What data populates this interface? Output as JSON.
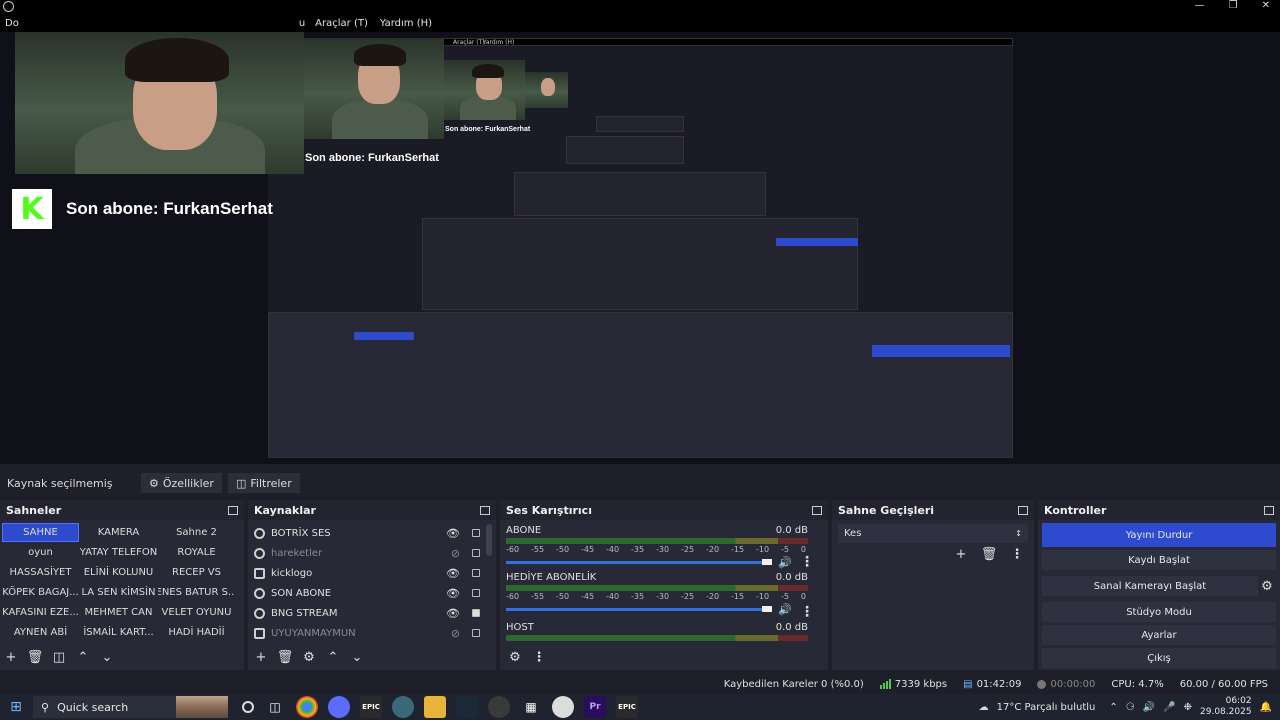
{
  "menubar": {
    "items": [
      "Do",
      "u",
      "Araçlar (T)",
      "Yardım (H)"
    ]
  },
  "preview": {
    "sub_label_main": "Son abone: FurkanSerhat",
    "sub_label_nested1": "Son abone: FurkanSerhat",
    "sub_label_nested2": "Son abone: FurkanSerhat",
    "nested_menu": [
      "Araçlar (T)",
      "Yardım (H)"
    ],
    "kick_letter": "K"
  },
  "source_bar": {
    "label": "Kaynak seçilmemiş",
    "properties": "Özellikler",
    "filters": "Filtreler"
  },
  "scenes": {
    "title": "Sahneler",
    "items": [
      "SAHNE",
      "KAMERA",
      "Sahne 2",
      "oyun",
      "YATAY TELEFON",
      "ROYALE",
      "HASSASİYET",
      "ELİNİ KOLUNU",
      "RECEP VS",
      "KÖPEK BAGAJ...",
      "LA SEN KİMSİN",
      "ENES BATUR S...",
      "KAFASINI EZE...",
      "MEHMET CAN",
      "VELET OYUNU",
      "AYNEN ABİ",
      "İSMAİL KART...",
      "HADİ HADİİ"
    ]
  },
  "sources": {
    "title": "Kaynaklar",
    "items": [
      {
        "name": "BOTRİX SES",
        "dim": false
      },
      {
        "name": "hareketler",
        "dim": true
      },
      {
        "name": "kicklogo",
        "dim": false
      },
      {
        "name": "SON ABONE",
        "dim": false
      },
      {
        "name": "BNG STREAM",
        "dim": false
      },
      {
        "name": "UYUYANMAYMUN",
        "dim": true
      }
    ]
  },
  "mixer": {
    "title": "Ses Karıştırıcı",
    "ticks": [
      "-60",
      "-55",
      "-50",
      "-45",
      "-40",
      "-35",
      "-30",
      "-25",
      "-20",
      "-15",
      "-10",
      "-5",
      "0"
    ],
    "channels": [
      {
        "name": "ABONE",
        "db": "0.0 dB"
      },
      {
        "name": "HEDİYE ABONELİK",
        "db": "0.0 dB"
      },
      {
        "name": "HOST",
        "db": "0.0 dB"
      }
    ]
  },
  "transitions": {
    "title": "Sahne Geçişleri",
    "selected": "Kes"
  },
  "controls": {
    "title": "Kontroller",
    "stop_stream": "Yayını Durdur",
    "start_record": "Kaydı Başlat",
    "virtual_cam": "Sanal Kamerayı Başlat",
    "studio_mode": "Stüdyo Modu",
    "settings": "Ayarlar",
    "exit": "Çıkış"
  },
  "status": {
    "dropped": "Kaybedilen Kareler 0 (%0.0)",
    "bitrate": "7339 kbps",
    "stream_time": "01:42:09",
    "rec_time": "00:00:00",
    "cpu": "CPU: 4.7%",
    "fps": "60.00 / 60.00 FPS"
  },
  "taskbar": {
    "search": "Quick search",
    "weather": "17°C  Parçalı bulutlu",
    "time": "06:02",
    "date": "29.08.2025"
  },
  "colors": {
    "accent": "#2e4bd0",
    "dock_bg": "#272936",
    "kick_green": "#53fc18"
  }
}
